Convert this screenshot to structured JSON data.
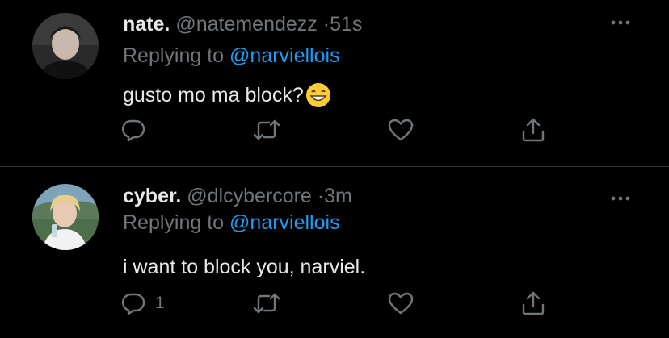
{
  "tweets": [
    {
      "display_name": "nate.",
      "handle": "@natemendezz",
      "separator": "·",
      "time": "51s",
      "replying_prefix": "Replying to",
      "replying_to": "@narviellois",
      "text": "gusto mo ma block?",
      "emoji": "grinning-face-emoji",
      "reply_count": "",
      "actions": [
        "reply-icon",
        "retweet-icon",
        "like-icon",
        "share-icon"
      ]
    },
    {
      "display_name": "cyber.",
      "handle": "@dlcybercore",
      "separator": "·",
      "time": "3m",
      "replying_prefix": "Replying to",
      "replying_to": "@narviellois",
      "text": "i want to block you, narviel.",
      "reply_count": "1",
      "actions": [
        "reply-icon",
        "retweet-icon",
        "like-icon",
        "share-icon"
      ]
    }
  ],
  "colors": {
    "background": "#000000",
    "text_primary": "#e7e9ea",
    "text_secondary": "#71767b",
    "link": "#1d9bf0",
    "divider": "#2f3336"
  }
}
